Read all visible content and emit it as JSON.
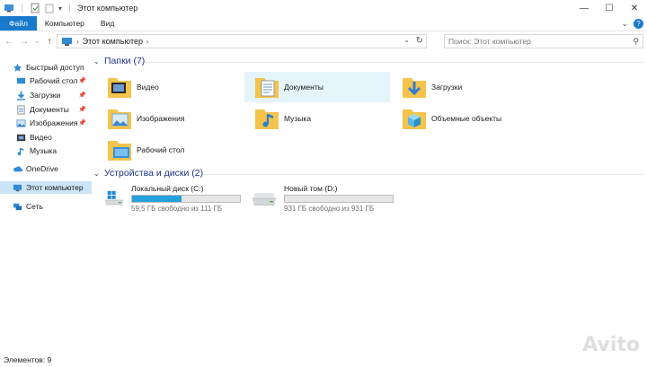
{
  "window": {
    "title": "Этот компьютер",
    "controls": {
      "minimize": "—",
      "maximize": "☐",
      "close": "✕"
    }
  },
  "ribbon": {
    "tabs": [
      {
        "label": "Файл",
        "active": true
      },
      {
        "label": "Компьютер"
      },
      {
        "label": "Вид"
      }
    ]
  },
  "nav": {
    "breadcrumb": "Этот компьютер",
    "search_placeholder": "Поиск: Этот компьютер"
  },
  "sidebar": {
    "items": [
      {
        "label": "Быстрый доступ",
        "icon": "star-icon"
      },
      {
        "label": "Рабочий стол",
        "icon": "desktop-icon",
        "pinned": true
      },
      {
        "label": "Загрузки",
        "icon": "download-icon",
        "pinned": true
      },
      {
        "label": "Документы",
        "icon": "document-icon",
        "pinned": true
      },
      {
        "label": "Изображения",
        "icon": "image-icon",
        "pinned": true
      },
      {
        "label": "Видео",
        "icon": "video-icon"
      },
      {
        "label": "Музыка",
        "icon": "music-icon"
      },
      {
        "label": "OneDrive",
        "icon": "cloud-icon"
      },
      {
        "label": "Этот компьютер",
        "icon": "computer-icon",
        "selected": true
      },
      {
        "label": "Сеть",
        "icon": "network-icon"
      }
    ]
  },
  "main": {
    "folders_header": "Папки (7)",
    "folders": [
      {
        "label": "Видео",
        "icon": "video-folder-icon"
      },
      {
        "label": "Документы",
        "icon": "documents-folder-icon",
        "selected": true
      },
      {
        "label": "Загрузки",
        "icon": "downloads-folder-icon"
      },
      {
        "label": "Изображения",
        "icon": "pictures-folder-icon"
      },
      {
        "label": "Музыка",
        "icon": "music-folder-icon"
      },
      {
        "label": "Объемные объекты",
        "icon": "3d-objects-folder-icon"
      },
      {
        "label": "Рабочий стол",
        "icon": "desktop-folder-icon"
      }
    ],
    "devices_header": "Устройства и диски (2)",
    "drives": [
      {
        "label": "Локальный диск (C:)",
        "free": "59,5 ГБ свободно из 111 ГБ",
        "used_fraction": 0.46,
        "icon": "windows-drive-icon"
      },
      {
        "label": "Новый том (D:)",
        "free": "931 ГБ свободно из 931 ГБ",
        "used_fraction": 0.0,
        "icon": "hard-drive-icon"
      }
    ]
  },
  "status": {
    "items_count": "Элементов: 9"
  },
  "watermark": "Avito",
  "colors": {
    "accent": "#1979ca",
    "selection": "#cce4f7",
    "header_text": "#1e3287",
    "drive_bar": "#26a0da"
  }
}
